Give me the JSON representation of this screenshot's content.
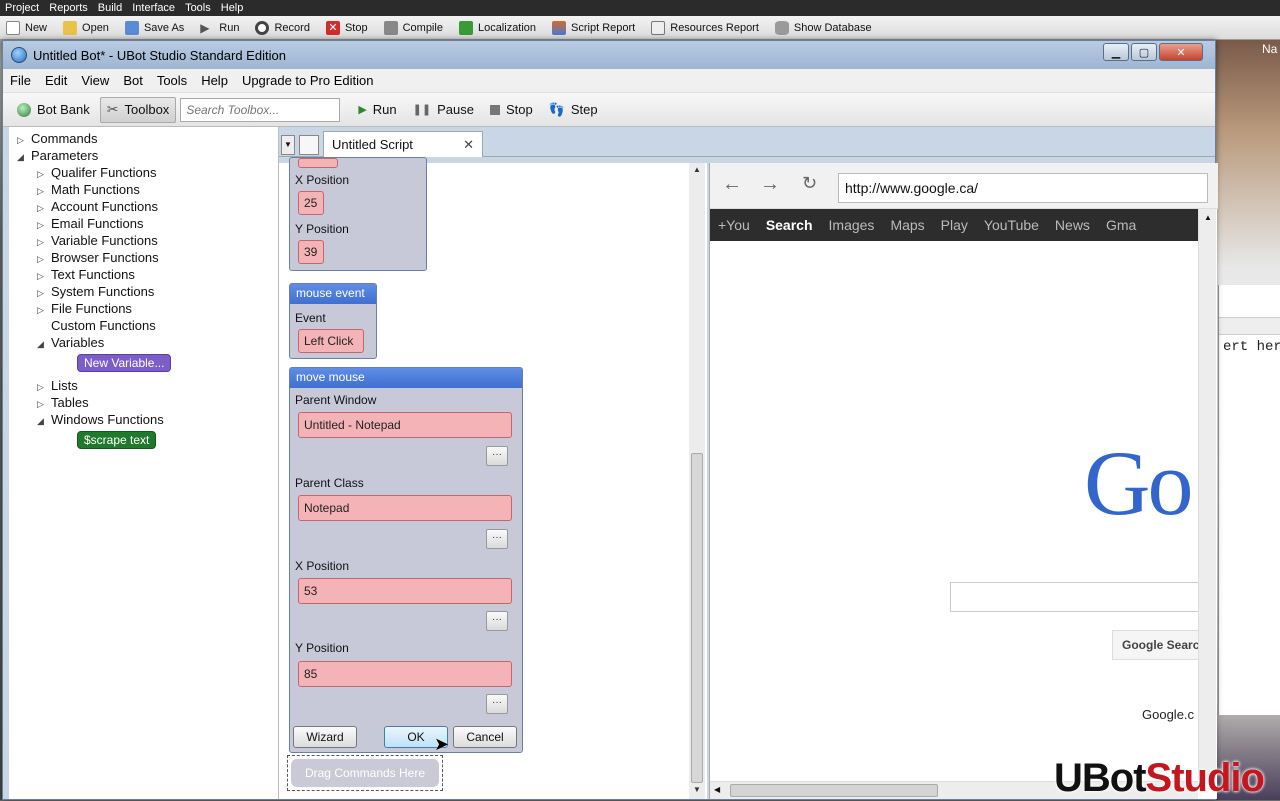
{
  "app_menubar": [
    "Project",
    "Reports",
    "Build",
    "Interface",
    "Tools",
    "Help"
  ],
  "app_toolbar": [
    {
      "label": "New",
      "color": "#ffffff"
    },
    {
      "label": "Open",
      "color": "#e7c34a"
    },
    {
      "label": "Save As",
      "color": "#5b8bd6"
    },
    {
      "label": "Run",
      "color": "#666666"
    },
    {
      "label": "Record",
      "color": "#444444"
    },
    {
      "label": "Stop",
      "color": "#d22b2b"
    },
    {
      "label": "Compile",
      "color": "#888888"
    },
    {
      "label": "Localization",
      "color": "#3a9a3a"
    },
    {
      "label": "Script Report",
      "color": "#d26a2b"
    },
    {
      "label": "Resources Report",
      "color": "#7a7a7a"
    },
    {
      "label": "Show Database",
      "color": "#9a9a9a"
    }
  ],
  "desktop": {
    "corner_text": "Na",
    "notepad_text": "ert here"
  },
  "window": {
    "title": "Untitled Bot* - UBot Studio Standard Edition",
    "menu": [
      "File",
      "Edit",
      "View",
      "Bot",
      "Tools",
      "Help",
      "Upgrade to Pro Edition"
    ],
    "toolbar": {
      "bot_bank": "Bot Bank",
      "toolbox": "Toolbox",
      "search_placeholder": "Search Toolbox...",
      "run": "Run",
      "pause": "Pause",
      "stop": "Stop",
      "step": "Step"
    }
  },
  "tree": {
    "commands": "Commands",
    "parameters": "Parameters",
    "functions": [
      "Qualifer Functions",
      "Math Functions",
      "Account Functions",
      "Email Functions",
      "Variable Functions",
      "Browser Functions",
      "Text Functions",
      "System Functions",
      "File Functions",
      "Custom Functions"
    ],
    "variables": "Variables",
    "new_variable": "New Variable...",
    "lists": "Lists",
    "tables": "Tables",
    "windows_functions": "Windows Functions",
    "scrape_text": "$scrape text",
    "variable_chip_color": "#7b5fc7",
    "scrape_chip_color": "#1f7a2c"
  },
  "script": {
    "tab_title": "Untitled Script",
    "block1": {
      "x_label": "X Position",
      "x_value": "25",
      "y_label": "Y Position",
      "y_value": "39"
    },
    "mouse_event": {
      "title": "mouse event",
      "event_label": "Event",
      "event_value": "Left Click"
    },
    "move_mouse": {
      "title": "move mouse",
      "parent_window_label": "Parent Window",
      "parent_window_value": "Untitled - Notepad",
      "parent_class_label": "Parent Class",
      "parent_class_value": "Notepad",
      "x_label": "X Position",
      "x_value": "53",
      "y_label": "Y Position",
      "y_value": "85",
      "wizard": "Wizard",
      "ok": "OK",
      "cancel": "Cancel"
    },
    "drag_here": "Drag Commands Here"
  },
  "browser": {
    "url": "http://www.google.ca/",
    "gbar": [
      "+You",
      "Search",
      "Images",
      "Maps",
      "Play",
      "YouTube",
      "News",
      "Gma"
    ],
    "gbar_selected": "Search",
    "logo": "Go",
    "search_button": "Google Searc",
    "footer": "Google.c"
  },
  "watermark": {
    "ubot": "UBot",
    "studio": "Studio",
    "ubot_color": "#111111",
    "studio_color": "#c4161c"
  }
}
